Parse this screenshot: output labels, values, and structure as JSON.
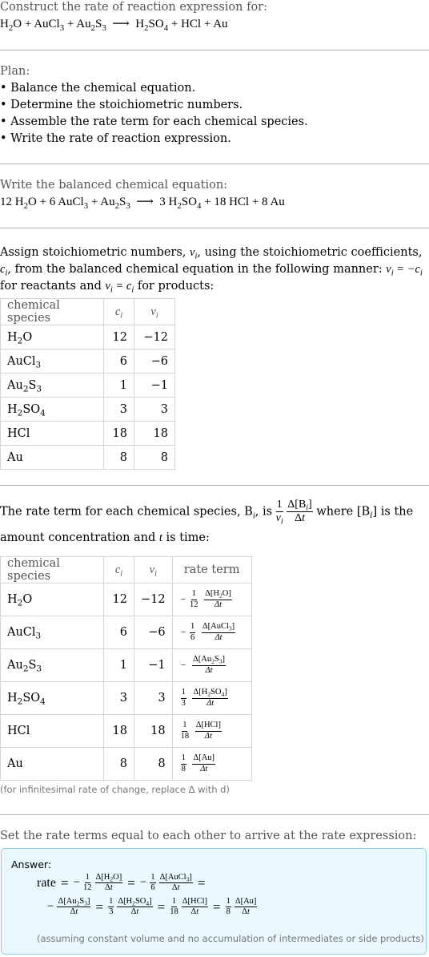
{
  "intro": {
    "header": "Construct the rate of reaction expression for:",
    "reaction": {
      "reactants": [
        [
          "H",
          "2",
          "O"
        ],
        [
          "AuCl",
          "3",
          ""
        ],
        [
          "Au",
          "2",
          "S",
          "3"
        ]
      ],
      "products": [
        [
          "H",
          "2",
          "SO",
          "4"
        ],
        [
          "HCl"
        ],
        [
          "Au"
        ]
      ],
      "arrow": "⟶",
      "plus": "+"
    }
  },
  "plan": {
    "header": "Plan:",
    "steps": [
      "• Balance the chemical equation.",
      "• Determine the stoichiometric numbers.",
      "• Assemble the rate term for each chemical species.",
      "• Write the rate of reaction expression."
    ]
  },
  "balanced": {
    "header": "Write the balanced chemical equation:",
    "coefficients": [
      "12",
      "6",
      "",
      "3",
      "18",
      "8"
    ]
  },
  "stoich": {
    "text_1": "Assign stoichiometric numbers, ",
    "text_2": ", using the stoichiometric coefficients, ",
    "text_3": ", from the balanced chemical equation in the following manner: ",
    "text_4": " for reactants and ",
    "text_5": " for products:",
    "table": {
      "headers": [
        "chemical species",
        "c",
        "ν"
      ],
      "rows": [
        {
          "species": "H₂O",
          "c": "12",
          "v": "−12"
        },
        {
          "species": "AuCl₃",
          "c": "6",
          "v": "−6"
        },
        {
          "species": "Au₂S₃",
          "c": "1",
          "v": "−1"
        },
        {
          "species": "H₂SO₄",
          "c": "3",
          "v": "3"
        },
        {
          "species": "HCl",
          "c": "18",
          "v": "18"
        },
        {
          "species": "Au",
          "c": "8",
          "v": "8"
        }
      ]
    }
  },
  "rateterm": {
    "text_1": "The rate term for each chemical species, B",
    "text_2": ", is ",
    "text_3": " where [B",
    "text_4": "] is the amount concentration and ",
    "text_5": " is time:",
    "table": {
      "headers": [
        "chemical species",
        "c",
        "ν",
        "rate term"
      ],
      "rows": [
        {
          "species": "H₂O",
          "c": "12",
          "v": "−12",
          "sign": "−",
          "coef": "12",
          "conc": "Δ[H₂O]"
        },
        {
          "species": "AuCl₃",
          "c": "6",
          "v": "−6",
          "sign": "−",
          "coef": "6",
          "conc": "Δ[AuCl₃]"
        },
        {
          "species": "Au₂S₃",
          "c": "1",
          "v": "−1",
          "sign": "−",
          "coef": "",
          "conc": "Δ[Au₂S₃]"
        },
        {
          "species": "H₂SO₄",
          "c": "3",
          "v": "3",
          "sign": "",
          "coef": "3",
          "conc": "Δ[H₂SO₄]"
        },
        {
          "species": "HCl",
          "c": "18",
          "v": "18",
          "sign": "",
          "coef": "18",
          "conc": "Δ[HCl]"
        },
        {
          "species": "Au",
          "c": "8",
          "v": "8",
          "sign": "",
          "coef": "8",
          "conc": "Δ[Au]"
        }
      ],
      "denominator": "Δt"
    },
    "note": "(for infinitesimal rate of change, replace Δ with d)"
  },
  "final": {
    "header": "Set the rate terms equal to each other to arrive at the rate expression:",
    "answer_label": "Answer:",
    "rate_word": "rate",
    "note": "(assuming constant volume and no accumulation of intermediates or side products)"
  }
}
